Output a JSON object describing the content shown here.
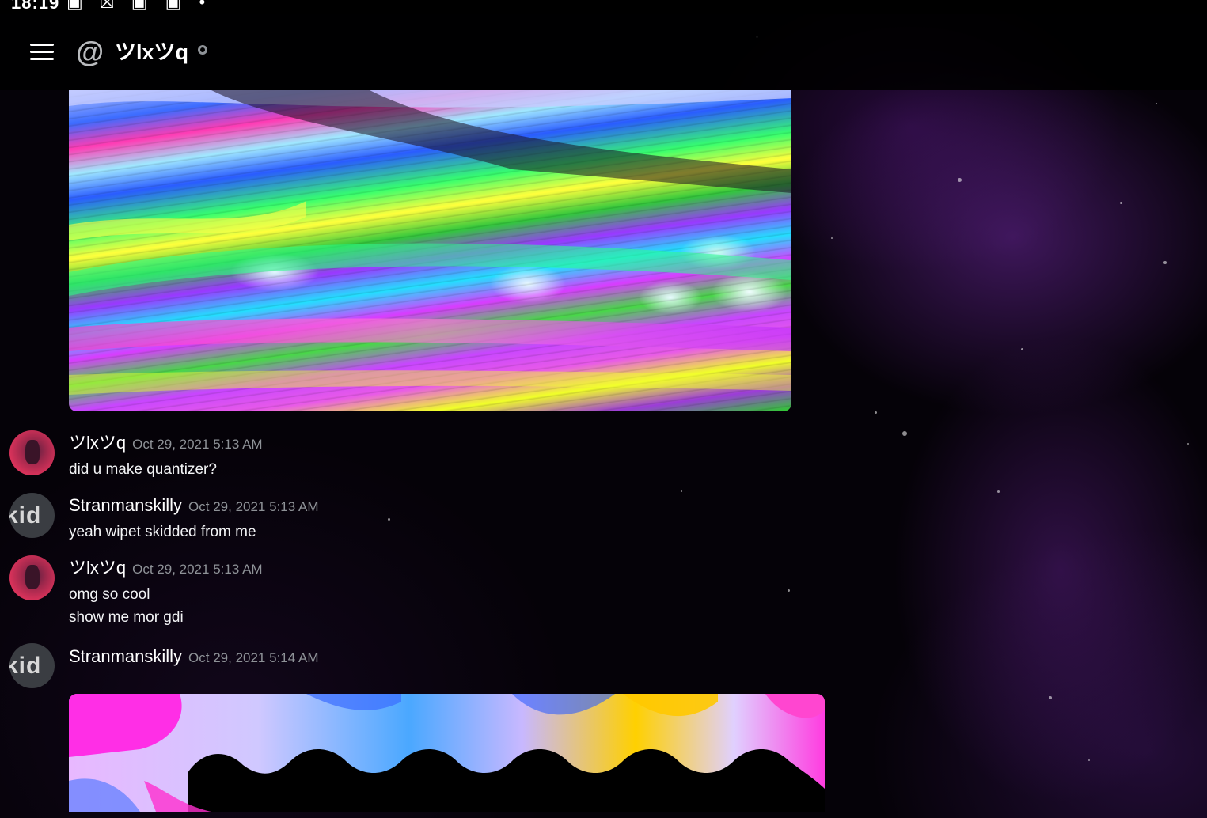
{
  "status_bar": {
    "time": "18:19",
    "icons": "▣ ⛝ ▣ ▣ •"
  },
  "header": {
    "at_symbol": "@",
    "channel_name": "ツlxツq"
  },
  "messages": [
    {
      "author": "ツlxツq",
      "timestamp": "Oct 29, 2021 5:13 AM",
      "lines": [
        "did u make quantizer?"
      ]
    },
    {
      "author": "Stranmanskilly",
      "avatar_text": "kid",
      "timestamp": "Oct 29, 2021 5:13 AM",
      "lines": [
        "yeah wipet skidded from me"
      ]
    },
    {
      "author": "ツlxツq",
      "timestamp": "Oct 29, 2021 5:13 AM",
      "lines": [
        "omg so cool",
        "show me mor gdi"
      ]
    },
    {
      "author": "Stranmanskilly",
      "avatar_text": "kid",
      "timestamp": "Oct 29, 2021 5:14 AM",
      "lines": []
    }
  ]
}
